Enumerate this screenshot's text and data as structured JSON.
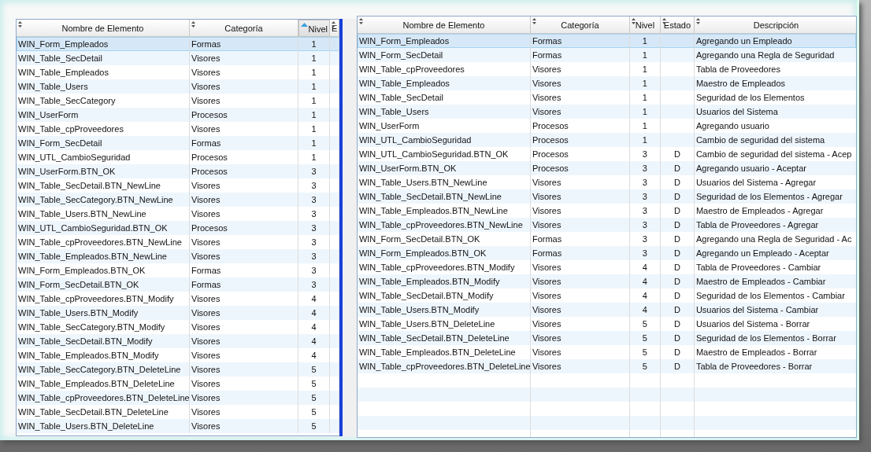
{
  "left_table": {
    "columns": [
      {
        "label": "Nombre de Elemento",
        "sorted": false
      },
      {
        "label": "Categoría",
        "sorted": false
      },
      {
        "label": "Nivel",
        "sorted": true
      },
      {
        "label": "E",
        "sorted": false
      }
    ],
    "rows": [
      {
        "selected": true,
        "name": "WIN_Form_Empleados",
        "category": "Formas",
        "nivel": "1"
      },
      {
        "selected": false,
        "name": "WIN_Table_SecDetail",
        "category": "Visores",
        "nivel": "1"
      },
      {
        "selected": false,
        "name": "WIN_Table_Empleados",
        "category": "Visores",
        "nivel": "1"
      },
      {
        "selected": false,
        "name": "WIN_Table_Users",
        "category": "Visores",
        "nivel": "1"
      },
      {
        "selected": false,
        "name": "WIN_Table_SecCategory",
        "category": "Visores",
        "nivel": "1"
      },
      {
        "selected": false,
        "name": "WIN_UserForm",
        "category": "Procesos",
        "nivel": "1"
      },
      {
        "selected": false,
        "name": "WIN_Table_cpProveedores",
        "category": "Visores",
        "nivel": "1"
      },
      {
        "selected": false,
        "name": "WIN_Form_SecDetail",
        "category": "Formas",
        "nivel": "1"
      },
      {
        "selected": false,
        "name": "WIN_UTL_CambioSeguridad",
        "category": "Procesos",
        "nivel": "1"
      },
      {
        "selected": false,
        "name": "WIN_UserForm.BTN_OK",
        "category": "Procesos",
        "nivel": "3"
      },
      {
        "selected": false,
        "name": "WIN_Table_SecDetail.BTN_NewLine",
        "category": "Visores",
        "nivel": "3"
      },
      {
        "selected": false,
        "name": "WIN_Table_SecCategory.BTN_NewLine",
        "category": "Visores",
        "nivel": "3"
      },
      {
        "selected": false,
        "name": "WIN_Table_Users.BTN_NewLine",
        "category": "Visores",
        "nivel": "3"
      },
      {
        "selected": false,
        "name": "WIN_UTL_CambioSeguridad.BTN_OK",
        "category": "Procesos",
        "nivel": "3"
      },
      {
        "selected": false,
        "name": "WIN_Table_cpProveedores.BTN_NewLine",
        "category": "Visores",
        "nivel": "3"
      },
      {
        "selected": false,
        "name": "WIN_Table_Empleados.BTN_NewLine",
        "category": "Visores",
        "nivel": "3"
      },
      {
        "selected": false,
        "name": "WIN_Form_Empleados.BTN_OK",
        "category": "Formas",
        "nivel": "3"
      },
      {
        "selected": false,
        "name": "WIN_Form_SecDetail.BTN_OK",
        "category": "Formas",
        "nivel": "3"
      },
      {
        "selected": false,
        "name": "WIN_Table_cpProveedores.BTN_Modify",
        "category": "Visores",
        "nivel": "4"
      },
      {
        "selected": false,
        "name": "WIN_Table_Users.BTN_Modify",
        "category": "Visores",
        "nivel": "4"
      },
      {
        "selected": false,
        "name": "WIN_Table_SecCategory.BTN_Modify",
        "category": "Visores",
        "nivel": "4"
      },
      {
        "selected": false,
        "name": "WIN_Table_SecDetail.BTN_Modify",
        "category": "Visores",
        "nivel": "4"
      },
      {
        "selected": false,
        "name": "WIN_Table_Empleados.BTN_Modify",
        "category": "Visores",
        "nivel": "4"
      },
      {
        "selected": false,
        "name": "WIN_Table_SecCategory.BTN_DeleteLine",
        "category": "Visores",
        "nivel": "5"
      },
      {
        "selected": false,
        "name": "WIN_Table_Empleados.BTN_DeleteLine",
        "category": "Visores",
        "nivel": "5"
      },
      {
        "selected": false,
        "name": "WIN_Table_cpProveedores.BTN_DeleteLine",
        "category": "Visores",
        "nivel": "5"
      },
      {
        "selected": false,
        "name": "WIN_Table_SecDetail.BTN_DeleteLine",
        "category": "Visores",
        "nivel": "5"
      },
      {
        "selected": false,
        "name": "WIN_Table_Users.BTN_DeleteLine",
        "category": "Visores",
        "nivel": "5"
      }
    ]
  },
  "right_table": {
    "columns": [
      {
        "label": "Nombre de Elemento",
        "sorted": false
      },
      {
        "label": "Categoría",
        "sorted": false
      },
      {
        "label": "Nivel",
        "sorted": false
      },
      {
        "label": "Estado",
        "sorted": false
      },
      {
        "label": "Descripción",
        "sorted": false
      }
    ],
    "rows": [
      {
        "selected": true,
        "name": "WIN_Form_Empleados",
        "category": "Formas",
        "nivel": "1",
        "description": "Agregando un Empleado"
      },
      {
        "selected": false,
        "name": "WIN_Form_SecDetail",
        "category": "Formas",
        "nivel": "1",
        "description": "Agregando una Regla de Seguridad"
      },
      {
        "selected": false,
        "name": "WIN_Table_cpProveedores",
        "category": "Visores",
        "nivel": "1",
        "description": "Tabla de Proveedores"
      },
      {
        "selected": false,
        "name": "WIN_Table_Empleados",
        "category": "Visores",
        "nivel": "1",
        "description": "Maestro de Empleados"
      },
      {
        "selected": false,
        "name": "WIN_Table_SecDetail",
        "category": "Visores",
        "nivel": "1",
        "description": "Seguridad de los Elementos"
      },
      {
        "selected": false,
        "name": "WIN_Table_Users",
        "category": "Visores",
        "nivel": "1",
        "description": "Usuarios del Sistema"
      },
      {
        "selected": false,
        "name": "WIN_UserForm",
        "category": "Procesos",
        "nivel": "1",
        "description": "Agregando usuario"
      },
      {
        "selected": false,
        "name": "WIN_UTL_CambioSeguridad",
        "category": "Procesos",
        "nivel": "1",
        "description": "Cambio de seguridad del sistema"
      },
      {
        "selected": false,
        "name": "WIN_UTL_CambioSeguridad.BTN_OK",
        "category": "Procesos",
        "nivel": "3",
        "estado": "D",
        "description": "Cambio de seguridad del sistema - Acep"
      },
      {
        "selected": false,
        "name": "WIN_UserForm.BTN_OK",
        "category": "Procesos",
        "nivel": "3",
        "estado": "D",
        "description": "Agregando usuario - Aceptar"
      },
      {
        "selected": false,
        "name": "WIN_Table_Users.BTN_NewLine",
        "category": "Visores",
        "nivel": "3",
        "estado": "D",
        "description": "Usuarios del Sistema - Agregar"
      },
      {
        "selected": false,
        "name": "WIN_Table_SecDetail.BTN_NewLine",
        "category": "Visores",
        "nivel": "3",
        "estado": "D",
        "description": "Seguridad de los Elementos - Agregar"
      },
      {
        "selected": false,
        "name": "WIN_Table_Empleados.BTN_NewLine",
        "category": "Visores",
        "nivel": "3",
        "estado": "D",
        "description": "Maestro de Empleados - Agregar"
      },
      {
        "selected": false,
        "name": "WIN_Table_cpProveedores.BTN_NewLine",
        "category": "Visores",
        "nivel": "3",
        "estado": "D",
        "description": "Tabla de Proveedores - Agregar"
      },
      {
        "selected": false,
        "name": "WIN_Form_SecDetail.BTN_OK",
        "category": "Formas",
        "nivel": "3",
        "estado": "D",
        "description": "Agregando una Regla de Seguridad - Ac"
      },
      {
        "selected": false,
        "name": "WIN_Form_Empleados.BTN_OK",
        "category": "Formas",
        "nivel": "3",
        "estado": "D",
        "description": "Agregando un Empleado - Aceptar"
      },
      {
        "selected": false,
        "name": "WIN_Table_cpProveedores.BTN_Modify",
        "category": "Visores",
        "nivel": "4",
        "estado": "D",
        "description": "Tabla de Proveedores - Cambiar"
      },
      {
        "selected": false,
        "name": "WIN_Table_Empleados.BTN_Modify",
        "category": "Visores",
        "nivel": "4",
        "estado": "D",
        "description": "Maestro de Empleados - Cambiar"
      },
      {
        "selected": false,
        "name": "WIN_Table_SecDetail.BTN_Modify",
        "category": "Visores",
        "nivel": "4",
        "estado": "D",
        "description": "Seguridad de los Elementos - Cambiar"
      },
      {
        "selected": false,
        "name": "WIN_Table_Users.BTN_Modify",
        "category": "Visores",
        "nivel": "4",
        "estado": "D",
        "description": "Usuarios del Sistema - Cambiar"
      },
      {
        "selected": false,
        "name": "WIN_Table_Users.BTN_DeleteLine",
        "category": "Visores",
        "nivel": "5",
        "estado": "D",
        "description": "Usuarios del Sistema - Borrar"
      },
      {
        "selected": false,
        "name": "WIN_Table_SecDetail.BTN_DeleteLine",
        "category": "Visores",
        "nivel": "5",
        "estado": "D",
        "description": "Seguridad de los Elementos - Borrar"
      },
      {
        "selected": false,
        "name": "WIN_Table_Empleados.BTN_DeleteLine",
        "category": "Visores",
        "nivel": "5",
        "estado": "D",
        "description": "Maestro de Empleados - Borrar"
      },
      {
        "selected": false,
        "name": "WIN_Table_cpProveedores.BTN_DeleteLine",
        "category": "Visores",
        "nivel": "5",
        "estado": "D",
        "description": "Tabla de Proveedores - Borrar"
      }
    ]
  }
}
